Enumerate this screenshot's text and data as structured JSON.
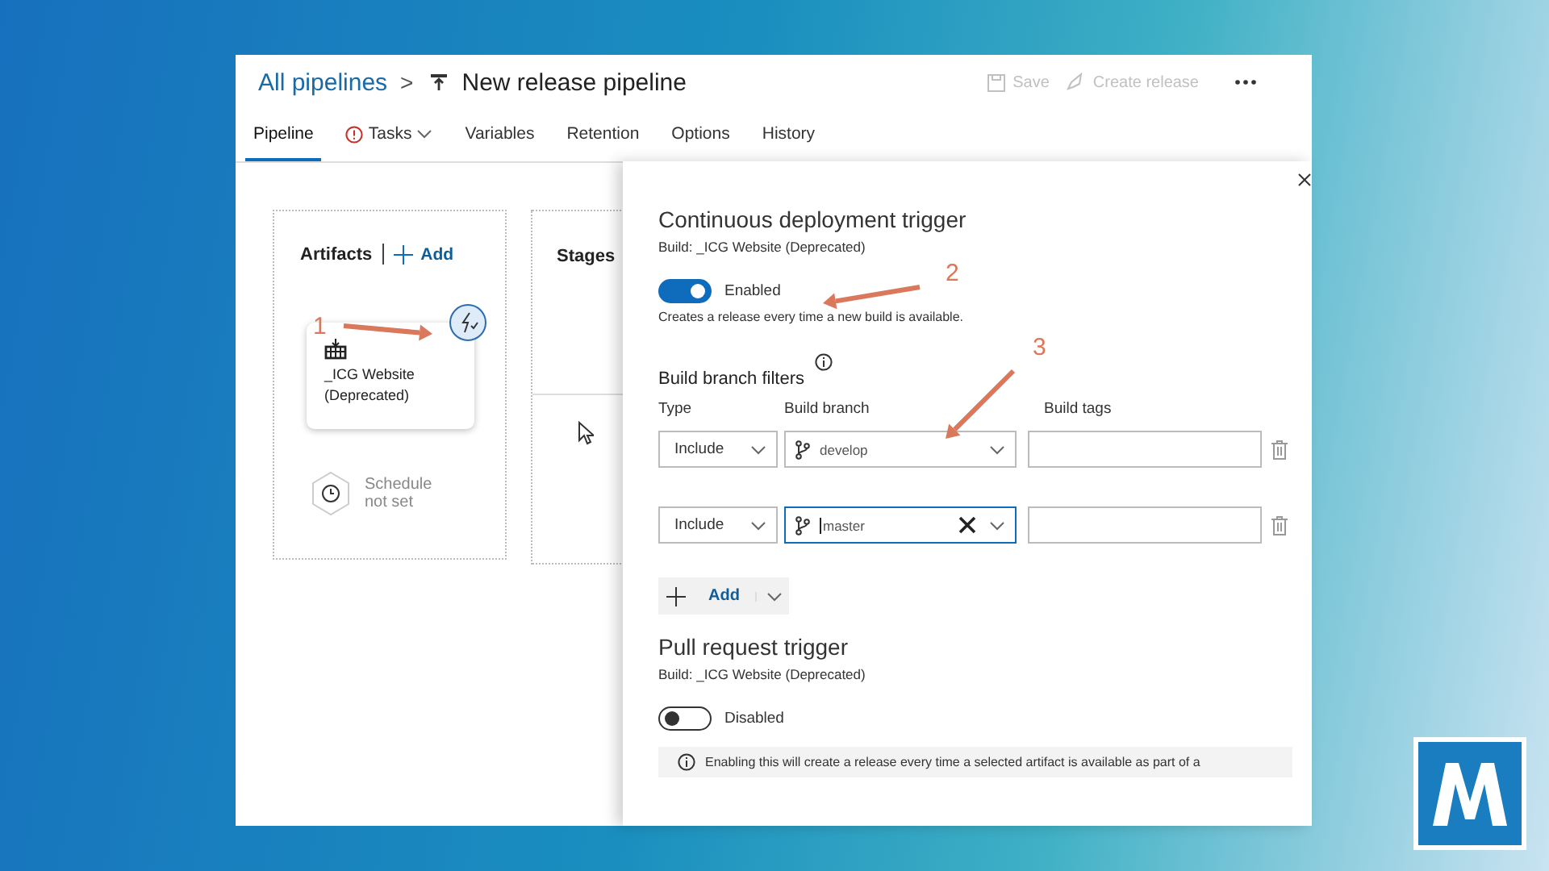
{
  "breadcrumb": {
    "parent": "All pipelines",
    "separator": ">",
    "title": "New release pipeline"
  },
  "toolbar": [
    {
      "label": "Save",
      "kind": "save",
      "disabled": true
    },
    {
      "label": "Create release",
      "kind": "release",
      "disabled": true
    }
  ],
  "tabs": [
    {
      "label": "Pipeline",
      "selected": true,
      "warning": false,
      "dropdown": false
    },
    {
      "label": "Tasks",
      "selected": false,
      "warning": true,
      "dropdown": true
    },
    {
      "label": "Variables",
      "selected": false,
      "warning": false,
      "dropdown": false
    },
    {
      "label": "Retention",
      "selected": false,
      "warning": false,
      "dropdown": false
    },
    {
      "label": "Options",
      "selected": false,
      "warning": false,
      "dropdown": false
    },
    {
      "label": "History",
      "selected": false,
      "warning": false,
      "dropdown": false
    }
  ],
  "artifacts": {
    "heading": "Artifacts",
    "add": "Add",
    "card": [
      "_ICG Website",
      "(Deprecated)"
    ],
    "schedule": [
      "Schedule",
      "not set"
    ]
  },
  "stages": {
    "heading": "Stages"
  },
  "panel": {
    "cd_trigger": {
      "title": "Continuous deployment trigger",
      "source": "Build: _ICG Website (Deprecated)",
      "toggle": {
        "on": true,
        "label": "Enabled"
      },
      "description": "Creates a release every time a new build is available."
    },
    "filters": {
      "title": "Build branch filters",
      "columns": [
        "Type",
        "Build branch",
        "Build tags"
      ],
      "rows": [
        {
          "type": "Include",
          "branch": "develop",
          "focused": false
        },
        {
          "type": "Include",
          "branch": "master",
          "focused": true
        }
      ],
      "add": "Add"
    },
    "pr_trigger": {
      "title": "Pull request trigger",
      "source": "Build: _ICG Website (Deprecated)",
      "toggle": {
        "on": false,
        "label": "Disabled"
      },
      "info": "Enabling this will create a release every time a selected artifact is available as part of a"
    }
  },
  "annotations": [
    {
      "label": "1"
    },
    {
      "label": "2"
    },
    {
      "label": "3"
    }
  ]
}
